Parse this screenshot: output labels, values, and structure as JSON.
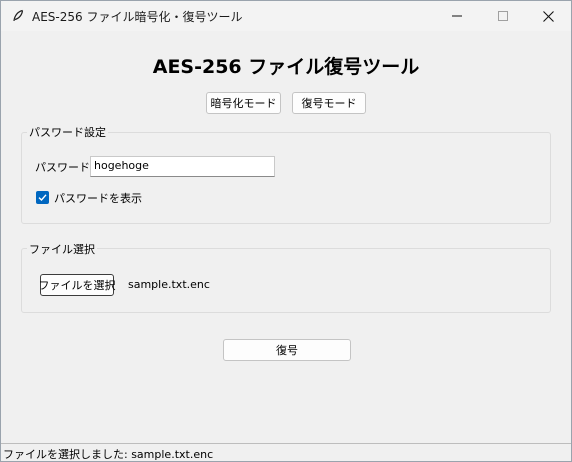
{
  "window": {
    "title": "AES-256 ファイル暗号化・復号ツール",
    "icon": "feather-icon"
  },
  "header": {
    "title": "AES-256 ファイル復号ツール"
  },
  "mode": {
    "encrypt_label": "暗号化モード",
    "decrypt_label": "復号モード"
  },
  "password_group": {
    "legend": "パスワード設定",
    "label": "パスワード:",
    "value": "hogehoge",
    "show_label": "パスワードを表示",
    "show_checked": true
  },
  "file_group": {
    "legend": "ファイル選択",
    "select_label": "ファイルを選択",
    "selected_file": "sample.txt.enc"
  },
  "action": {
    "decrypt_label": "復号"
  },
  "status": {
    "text": "ファイルを選択しました: sample.txt.enc"
  },
  "colors": {
    "accent": "#0067c0",
    "background": "#f0f0f0"
  }
}
